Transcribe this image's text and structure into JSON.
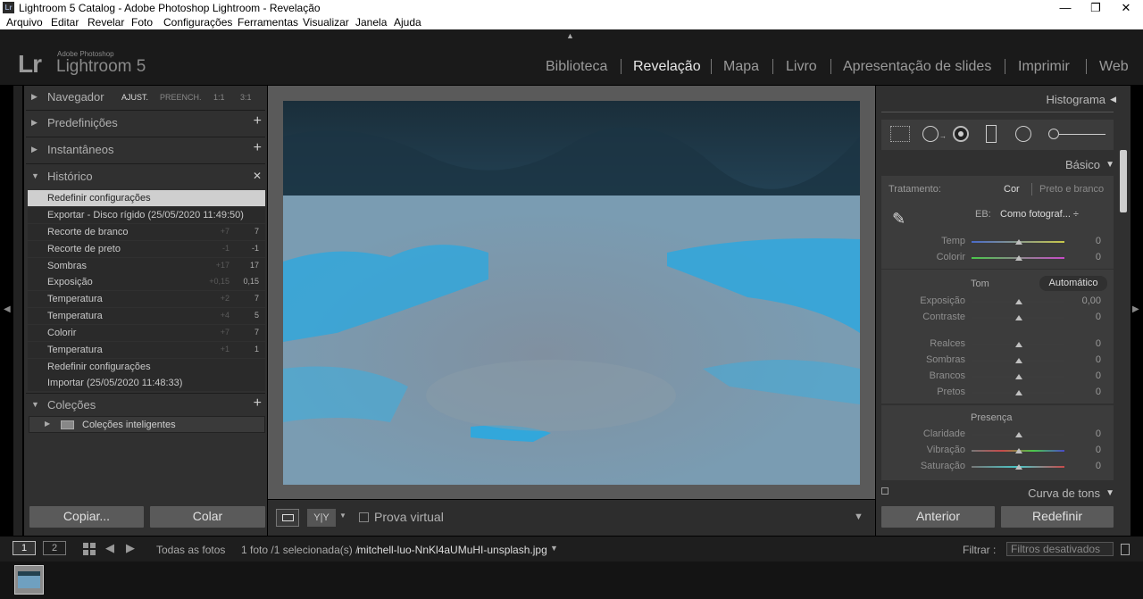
{
  "window": {
    "title": "Lightroom 5 Catalog - Adobe Photoshop Lightroom - Revelação",
    "minimize": "—",
    "maximize": "❐",
    "close": "✕"
  },
  "menu": [
    "Arquivo",
    "Editar",
    "Revelar",
    "Foto",
    "Configurações",
    "Ferramentas",
    "Visualizar",
    "Janela",
    "Ajuda"
  ],
  "brand": {
    "logo": "Lr",
    "company": "Adobe Photoshop",
    "product": "Lightroom 5"
  },
  "modules": [
    "Biblioteca",
    "Revelação",
    "Mapa",
    "Livro",
    "Apresentação de slides",
    "Imprimir",
    "Web"
  ],
  "active_module": "Revelação",
  "left": {
    "navigator": {
      "label": "Navegador",
      "zooms": [
        "AJUST.",
        "PREENCH.",
        "1:1",
        "3:1"
      ]
    },
    "presets": "Predefinições",
    "snapshots": "Instantâneos",
    "history": {
      "label": "Histórico",
      "close": "✕",
      "items": [
        {
          "label": "Redefinir configurações",
          "a": "",
          "b": ""
        },
        {
          "label": "Exportar - Disco rígido (25/05/2020 11:49:50)",
          "a": "",
          "b": ""
        },
        {
          "label": "Recorte de branco",
          "a": "+7",
          "b": "7"
        },
        {
          "label": "Recorte de preto",
          "a": "-1",
          "b": "-1"
        },
        {
          "label": "Sombras",
          "a": "+17",
          "b": "17"
        },
        {
          "label": "Exposição",
          "a": "+0,15",
          "b": "0,15"
        },
        {
          "label": "Temperatura",
          "a": "+2",
          "b": "7"
        },
        {
          "label": "Temperatura",
          "a": "+4",
          "b": "5"
        },
        {
          "label": "Colorir",
          "a": "+7",
          "b": "7"
        },
        {
          "label": "Temperatura",
          "a": "+1",
          "b": "1"
        },
        {
          "label": "Redefinir configurações",
          "a": "",
          "b": ""
        },
        {
          "label": "Importar (25/05/2020 11:48:33)",
          "a": "",
          "b": ""
        }
      ]
    },
    "collections": {
      "label": "Coleções",
      "smart": "Coleções inteligentes"
    },
    "copy_btn": "Copiar...",
    "paste_btn": "Colar"
  },
  "toolbar": {
    "softproof": "Prova virtual",
    "yy": "Y|Y"
  },
  "right": {
    "histogram": "Histograma",
    "basic": "Básico",
    "treatment": {
      "label": "Tratamento:",
      "color": "Cor",
      "bw": "Preto e branco"
    },
    "wb": {
      "label": "EB:",
      "value": "Como fotograf... ÷"
    },
    "temp_sliders": [
      {
        "label": "Temp",
        "value": "0",
        "pos": 0.5
      },
      {
        "label": "Colorir",
        "value": "0",
        "pos": 0.5
      }
    ],
    "tone": {
      "label": "Tom",
      "auto": "Automático"
    },
    "tone_sliders": [
      {
        "label": "Exposição",
        "value": "0,00",
        "pos": 0.5
      },
      {
        "label": "Contraste",
        "value": "0",
        "pos": 0.5
      }
    ],
    "tone_sliders2": [
      {
        "label": "Realces",
        "value": "0",
        "pos": 0.5
      },
      {
        "label": "Sombras",
        "value": "0",
        "pos": 0.5
      },
      {
        "label": "Brancos",
        "value": "0",
        "pos": 0.5
      },
      {
        "label": "Pretos",
        "value": "0",
        "pos": 0.5
      }
    ],
    "presence": "Presença",
    "presence_sliders": [
      {
        "label": "Claridade",
        "value": "0",
        "pos": 0.5
      },
      {
        "label": "Vibração",
        "value": "0",
        "pos": 0.5
      },
      {
        "label": "Saturação",
        "value": "0",
        "pos": 0.5
      }
    ],
    "tone_curve": "Curva de tons",
    "prev_btn": "Anterior",
    "reset_btn": "Redefinir"
  },
  "filmbar": {
    "screen1": "1",
    "screen2": "2",
    "source": "Todas as fotos",
    "info": "1 foto /1 selecionada(s) /",
    "filename": "mitchell-luo-NnKl4aUMuHI-unsplash.jpg",
    "filter_label": "Filtrar :",
    "filter_value": "Filtros desativados"
  },
  "colors": {
    "accent_blue": "#2aa8e0",
    "panel": "#303030",
    "photo_bg": "#7a9bb0"
  }
}
